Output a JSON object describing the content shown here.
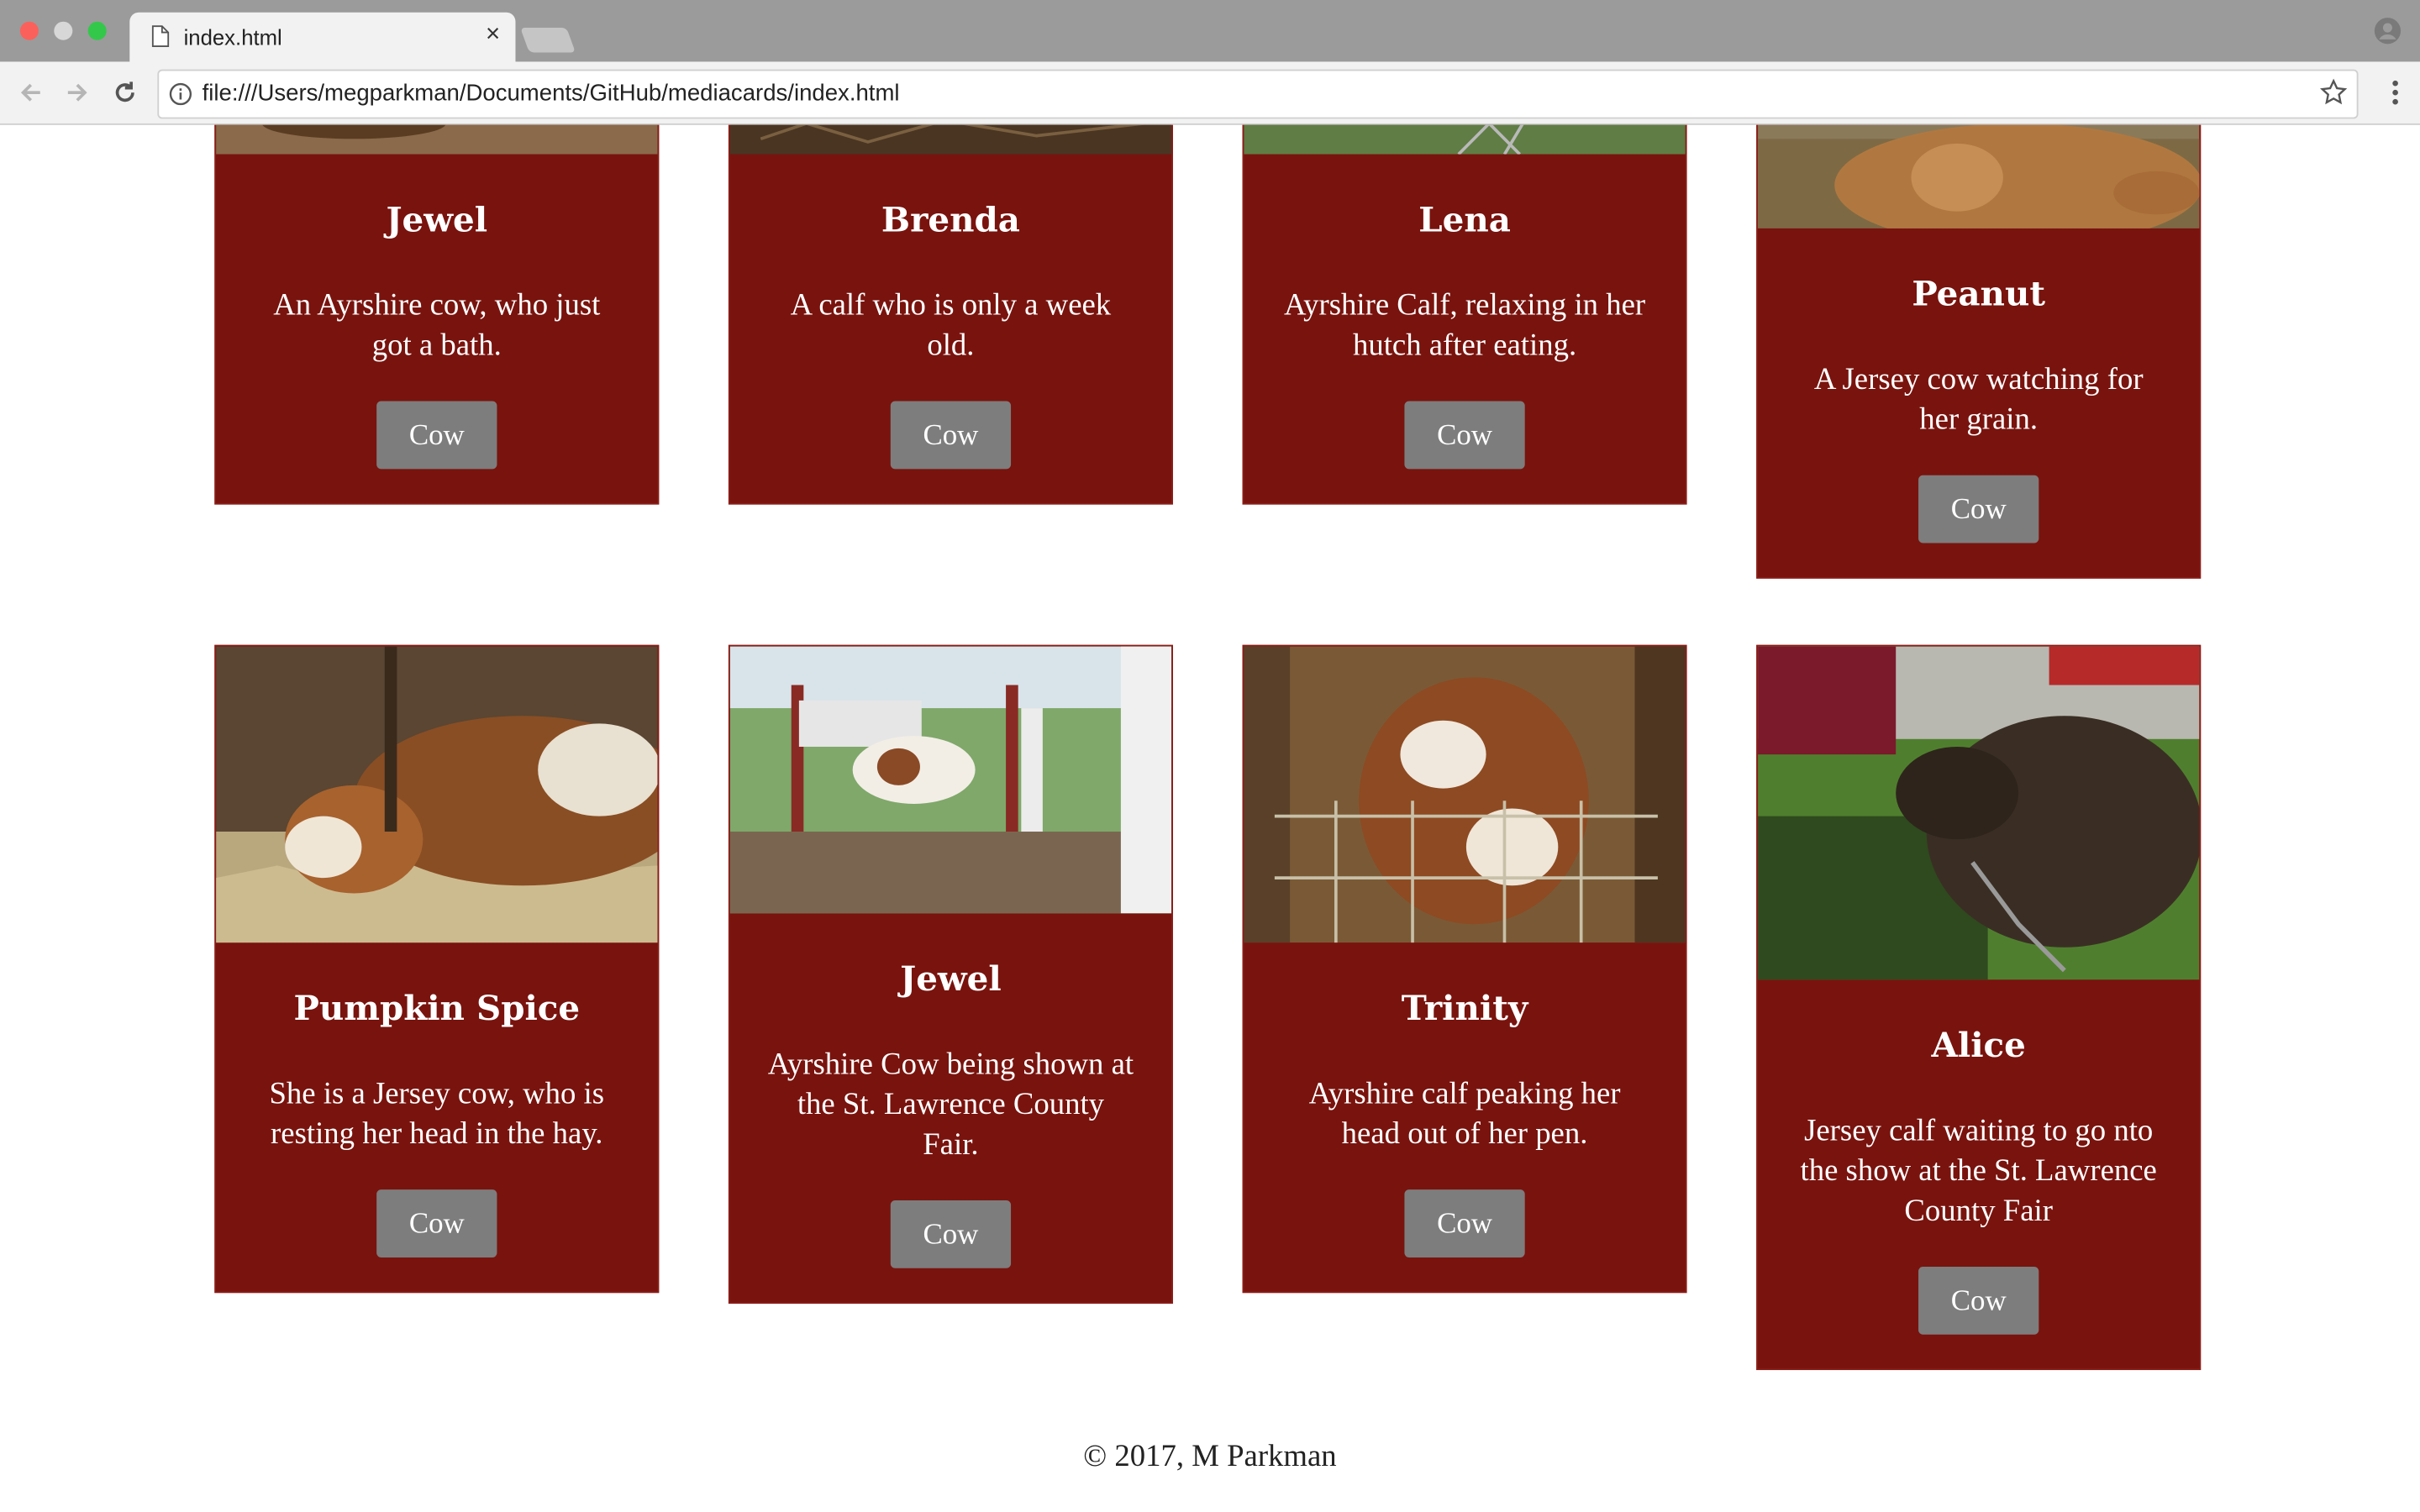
{
  "browser": {
    "tab_title": "index.html",
    "tab_close": "×",
    "url": "file:///Users/megparkman/Documents/GitHub/mediacards/index.html"
  },
  "cards": [
    {
      "name": "Jewel",
      "description": "An Ayrshire cow, who just got a bath.",
      "button": "Cow"
    },
    {
      "name": "Brenda",
      "description": "A calf who is only a week old.",
      "button": "Cow"
    },
    {
      "name": "Lena",
      "description": "Ayrshire Calf, relaxing in her hutch after eating.",
      "button": "Cow"
    },
    {
      "name": "Peanut",
      "description": "A Jersey cow watching for her grain.",
      "button": "Cow"
    },
    {
      "name": "Pumpkin Spice",
      "description": "She is a Jersey cow, who is resting her head in the hay.",
      "button": "Cow"
    },
    {
      "name": "Jewel",
      "description": "Ayrshire Cow being shown at the St. Lawrence County Fair.",
      "button": "Cow"
    },
    {
      "name": "Trinity",
      "description": "Ayrshire calf peaking her head out of her pen.",
      "button": "Cow"
    },
    {
      "name": "Alice",
      "description": "Jersey calf waiting to go nto the show at the St. Lawrence County Fair",
      "button": "Cow"
    }
  ],
  "footer": {
    "text": "© 2017, M Parkman"
  },
  "colors": {
    "card_bg": "#79130e",
    "button_bg": "#7d7d7d",
    "chrome_bg": "#f2f2f2"
  }
}
